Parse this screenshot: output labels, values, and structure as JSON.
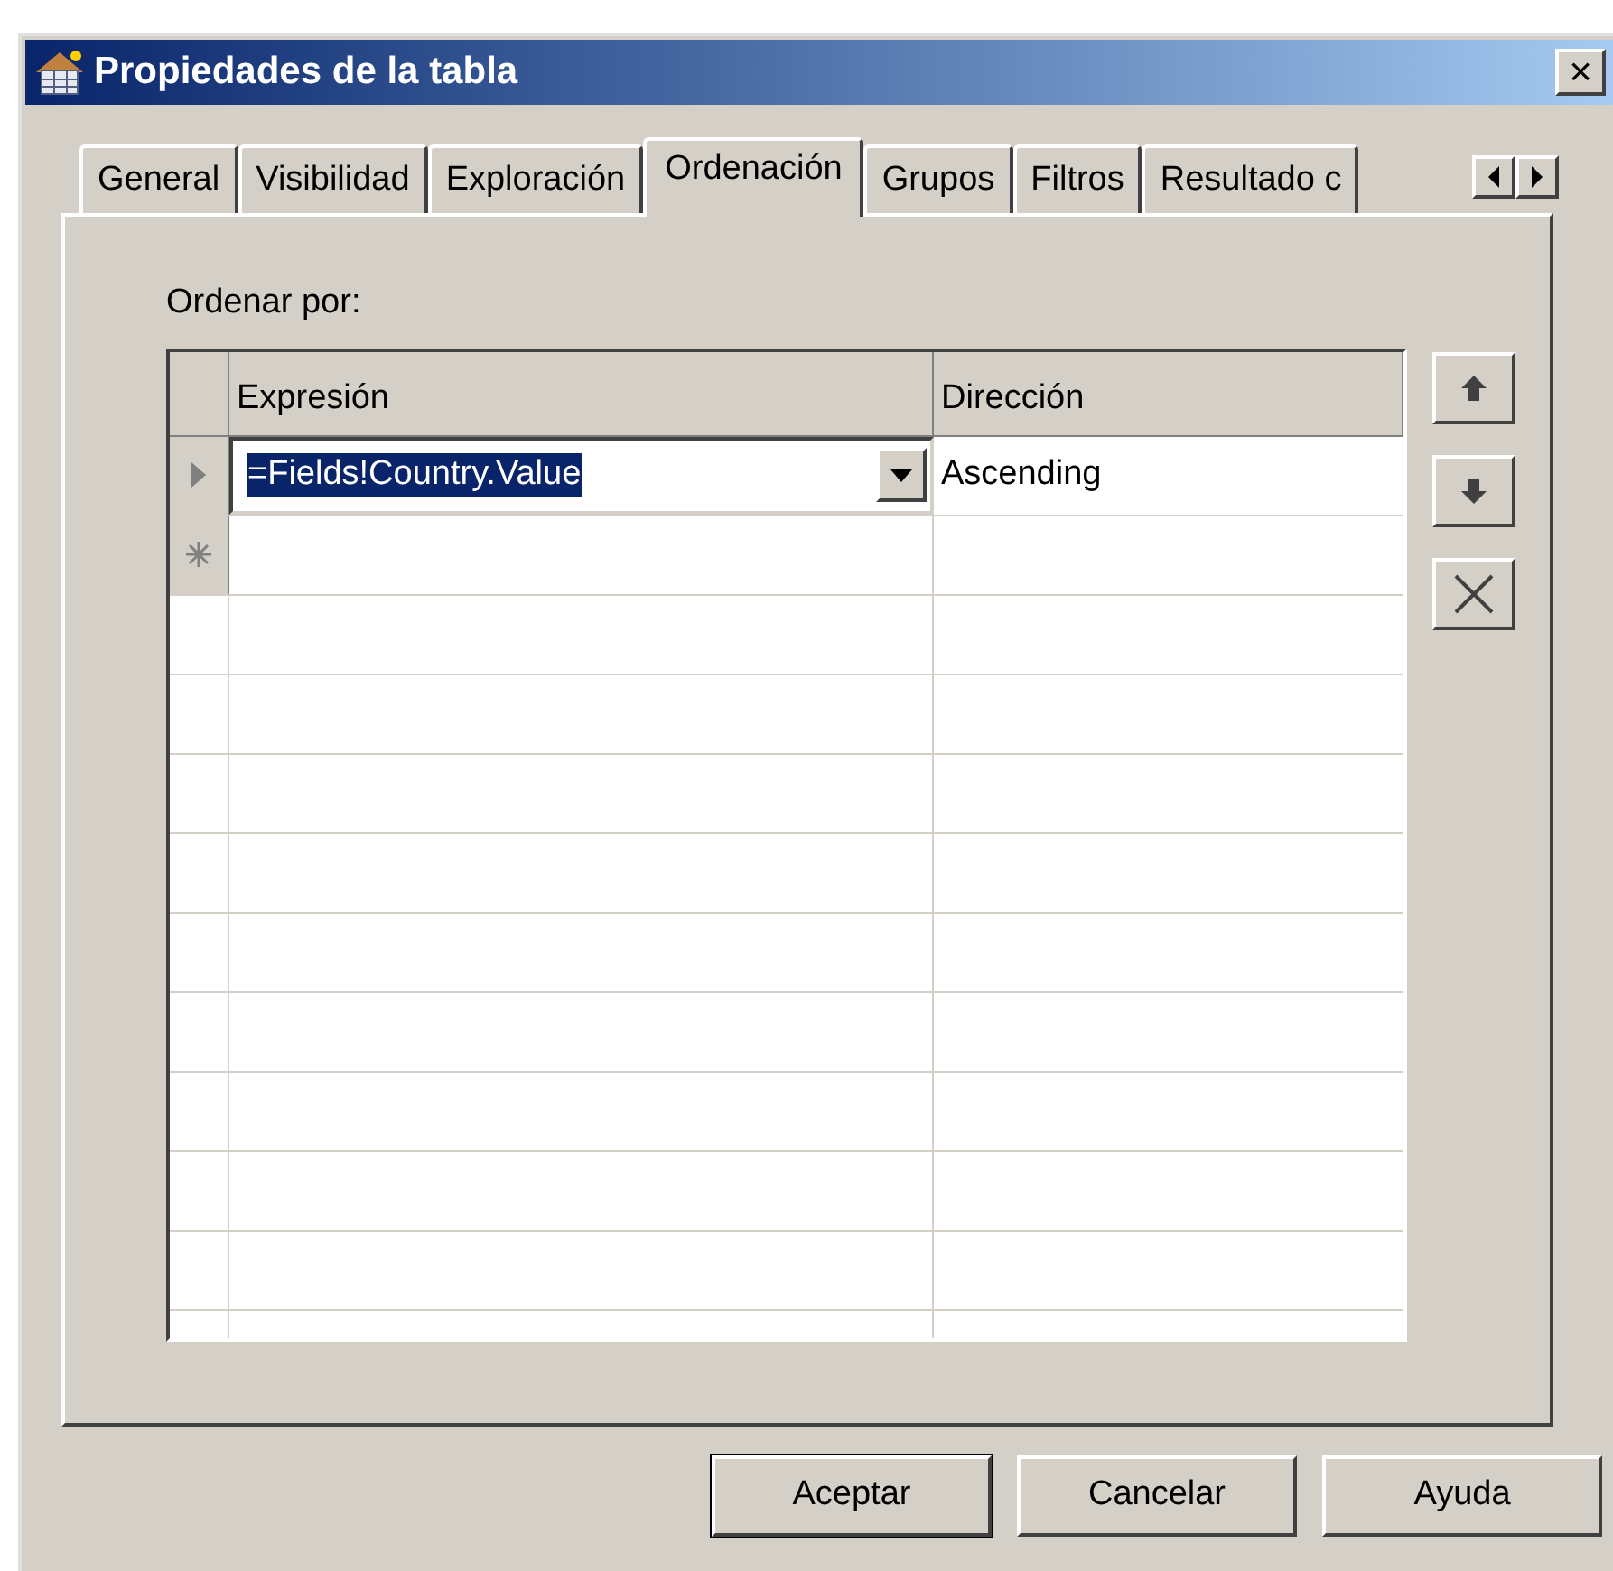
{
  "window": {
    "title": "Propiedades de la tabla",
    "close": "×"
  },
  "tabs": [
    {
      "label": "General",
      "selected": false
    },
    {
      "label": "Visibilidad",
      "selected": false
    },
    {
      "label": "Exploración",
      "selected": false
    },
    {
      "label": "Ordenación",
      "selected": true
    },
    {
      "label": "Grupos",
      "selected": false
    },
    {
      "label": "Filtros",
      "selected": false
    },
    {
      "label": "Resultado c",
      "selected": false
    }
  ],
  "sort": {
    "label": "Ordenar por:",
    "columns": [
      "Expresión",
      "Dirección"
    ],
    "rows": [
      {
        "kind": "current",
        "expression": "=Fields!Country.Value",
        "direction": "Ascending"
      },
      {
        "kind": "new"
      }
    ]
  },
  "buttons": [
    {
      "label": "Aceptar",
      "default": true
    },
    {
      "label": "Cancelar",
      "default": false
    },
    {
      "label": "Ayuda",
      "default": false
    }
  ]
}
